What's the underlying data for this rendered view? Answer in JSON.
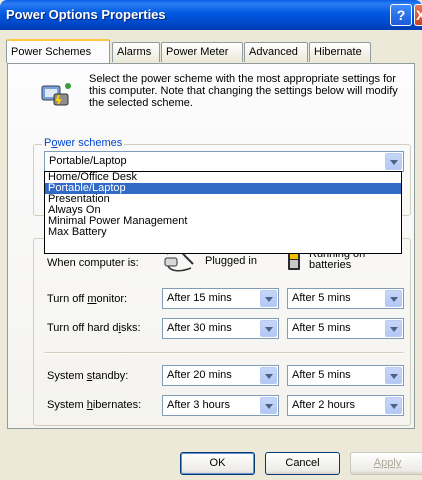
{
  "window": {
    "title": "Power Options Properties",
    "help_glyph": "?",
    "close_glyph": "X"
  },
  "tabs": [
    {
      "label": "Power Schemes",
      "active": true
    },
    {
      "label": "Alarms"
    },
    {
      "label": "Power Meter"
    },
    {
      "label": "Advanced"
    },
    {
      "label": "Hibernate"
    }
  ],
  "description": "Select the power scheme with the most appropriate settings for this computer. Note that changing the settings below will modify the selected scheme.",
  "power_schemes": {
    "group_label": "Power schemes",
    "selected": "Portable/Laptop",
    "options": [
      "Home/Office Desk",
      "Portable/Laptop",
      "Presentation",
      "Always On",
      "Minimal Power Management",
      "Max Battery"
    ]
  },
  "settings": {
    "when_label": "When computer is:",
    "plugged_in": "Plugged in",
    "running_on": "Running on",
    "batteries": "batteries",
    "rows": [
      {
        "label_pre": "Turn off ",
        "label_u": "m",
        "label_post": "onitor:",
        "plugged": "After 15 mins",
        "battery": "After 5 mins"
      },
      {
        "label_pre": "Turn off hard d",
        "label_u": "i",
        "label_post": "sks:",
        "plugged": "After 30 mins",
        "battery": "After 5 mins"
      },
      {
        "label_pre": "System ",
        "label_u": "s",
        "label_post": "tandby:",
        "plugged": "After 20 mins",
        "battery": "After 5 mins"
      },
      {
        "label_pre": "System ",
        "label_u": "h",
        "label_post": "ibernates:",
        "plugged": "After 3 hours",
        "battery": "After 2 hours"
      }
    ]
  },
  "buttons": {
    "ok": "OK",
    "cancel": "Cancel",
    "apply": "Apply"
  },
  "colors": {
    "titlebar": "#0058e0",
    "selection": "#316ac5",
    "group_label": "#0046d5",
    "dialog_bg": "#ece9d8"
  }
}
